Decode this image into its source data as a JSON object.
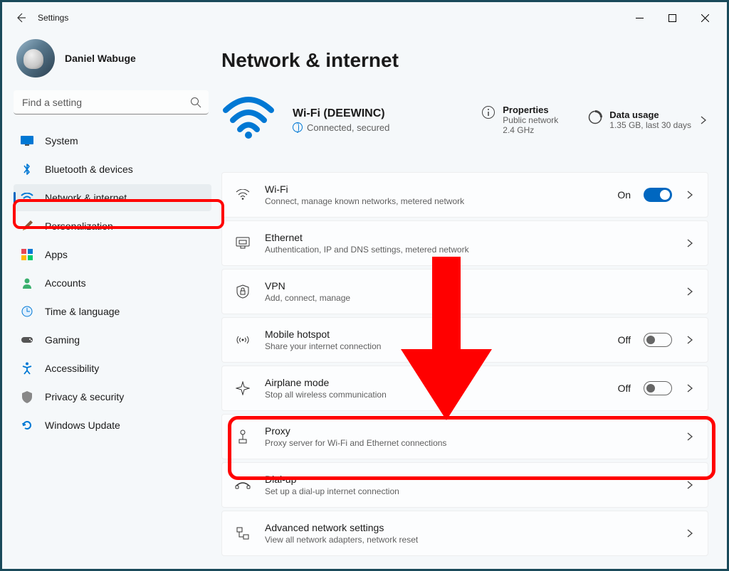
{
  "app_title": "Settings",
  "page_title": "Network & internet",
  "profile": {
    "name": "Daniel Wabuge"
  },
  "search": {
    "placeholder": "Find a setting"
  },
  "sidebar": {
    "items": [
      {
        "label": "System"
      },
      {
        "label": "Bluetooth & devices"
      },
      {
        "label": "Network & internet"
      },
      {
        "label": "Personalization"
      },
      {
        "label": "Apps"
      },
      {
        "label": "Accounts"
      },
      {
        "label": "Time & language"
      },
      {
        "label": "Gaming"
      },
      {
        "label": "Accessibility"
      },
      {
        "label": "Privacy & security"
      },
      {
        "label": "Windows Update"
      }
    ]
  },
  "status": {
    "wifi_name": "Wi-Fi (DEEWINC)",
    "wifi_state": "Connected, secured",
    "properties": {
      "title": "Properties",
      "sub1": "Public network",
      "sub2": "2.4 GHz"
    },
    "usage": {
      "title": "Data usage",
      "sub": "1.35 GB, last 30 days"
    }
  },
  "items": {
    "wifi": {
      "title": "Wi-Fi",
      "sub": "Connect, manage known networks, metered network",
      "toggle": "On"
    },
    "ethernet": {
      "title": "Ethernet",
      "sub": "Authentication, IP and DNS settings, metered network"
    },
    "vpn": {
      "title": "VPN",
      "sub": "Add, connect, manage"
    },
    "hotspot": {
      "title": "Mobile hotspot",
      "sub": "Share your internet connection",
      "toggle": "Off"
    },
    "airplane": {
      "title": "Airplane mode",
      "sub": "Stop all wireless communication",
      "toggle": "Off"
    },
    "proxy": {
      "title": "Proxy",
      "sub": "Proxy server for Wi-Fi and Ethernet connections"
    },
    "dialup": {
      "title": "Dial-up",
      "sub": "Set up a dial-up internet connection"
    },
    "advanced": {
      "title": "Advanced network settings",
      "sub": "View all network adapters, network reset"
    }
  },
  "colors": {
    "accent": "#0067c0",
    "highlight": "#ff0000"
  }
}
